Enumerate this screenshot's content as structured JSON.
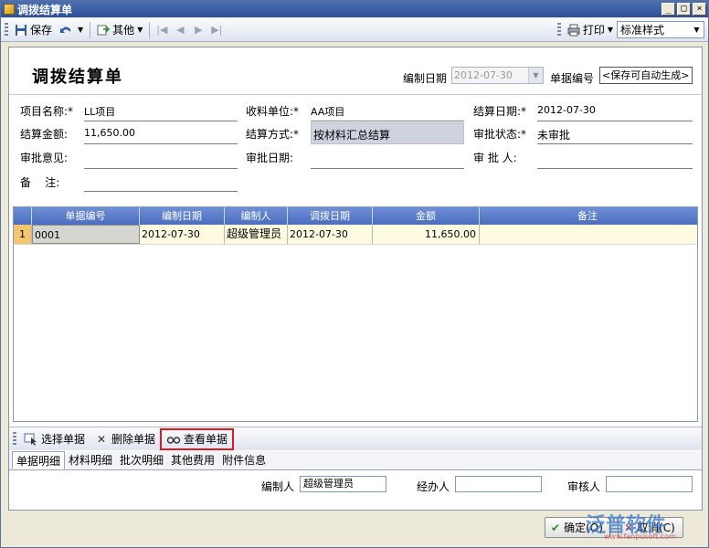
{
  "window": {
    "title": "调拨结算单"
  },
  "toolbar": {
    "save_label": "保存",
    "other_label": "其他",
    "print_label": "打印",
    "style_select": "标准样式"
  },
  "header": {
    "form_title": "调拨结算单",
    "date_label": "编制日期",
    "date_value": "2012-07-30",
    "bill_no_label": "单据编号",
    "bill_no_value": "<保存可自动生成>"
  },
  "fields": {
    "project_label": "项目名称:*",
    "project_value": "LL项目",
    "receiver_label": "收料单位:*",
    "receiver_value": "AA项目",
    "settle_date_label": "结算日期:*",
    "settle_date_value": "2012-07-30",
    "amount_label": "结算金额:",
    "amount_value": "11,650.00",
    "method_label": "结算方式:*",
    "method_value": "按材料汇总结算",
    "status_label": "审批状态:*",
    "status_value": "未审批",
    "opinion_label": "审批意见:",
    "approve_date_label": "审批日期:",
    "approver_label": "审 批 人:",
    "remark_label": "备    注:"
  },
  "grid": {
    "columns": [
      "单据编号",
      "编制日期",
      "编制人",
      "调拨日期",
      "金额",
      "备注"
    ],
    "rows": [
      {
        "num": "1",
        "bill_no": "0001",
        "date": "2012-07-30",
        "maker": "超级管理员",
        "transfer_date": "2012-07-30",
        "amount": "11,650.00",
        "remark": ""
      }
    ]
  },
  "bottom_toolbar": {
    "select_label": "选择单据",
    "delete_label": "删除单据",
    "view_label": "查看单据"
  },
  "tabs": [
    "单据明细",
    "材料明细",
    "批次明细",
    "其他费用",
    "附件信息"
  ],
  "footer": {
    "maker_label": "编制人",
    "maker_value": "超级管理员",
    "handler_label": "经办人",
    "handler_value": "",
    "reviewer_label": "审核人",
    "reviewer_value": ""
  },
  "actions": {
    "ok_label": "确定(O)",
    "cancel_label": "取消(C)"
  },
  "watermark": {
    "text": "泛普软件",
    "sub": "www.fanpusoft.com"
  },
  "colors": {
    "title_bar": "#2e4f96",
    "grid_header": "#4b6dbd",
    "highlight": "#e0191d"
  }
}
